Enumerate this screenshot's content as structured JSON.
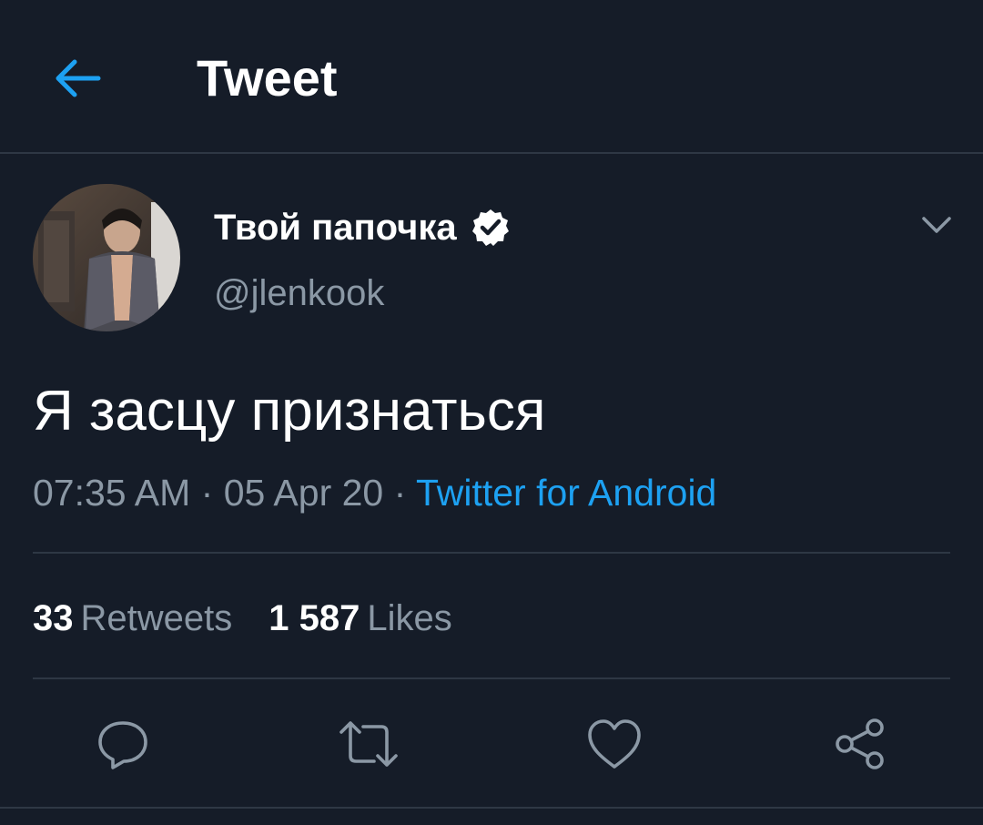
{
  "header": {
    "title": "Tweet",
    "back_icon": "arrow-left-icon",
    "accent": "#1da1f2"
  },
  "tweet": {
    "author": {
      "display_name": "Твой папочка",
      "handle": "@jlenkook",
      "verified": true
    },
    "text": "Я засцу признаться",
    "time": "07:35 AM",
    "date": "05 Apr 20",
    "separator": "·",
    "source": "Twitter for Android"
  },
  "stats": {
    "retweets_count": "33",
    "retweets_label": "Retweets",
    "likes_count": "1 587",
    "likes_label": "Likes"
  },
  "actions": {
    "reply_icon": "reply-icon",
    "retweet_icon": "retweet-icon",
    "like_icon": "heart-icon",
    "share_icon": "share-icon"
  },
  "colors": {
    "background": "#151c28",
    "divider": "#2e3744",
    "muted_text": "#8b98a5",
    "link": "#1da1f2"
  }
}
